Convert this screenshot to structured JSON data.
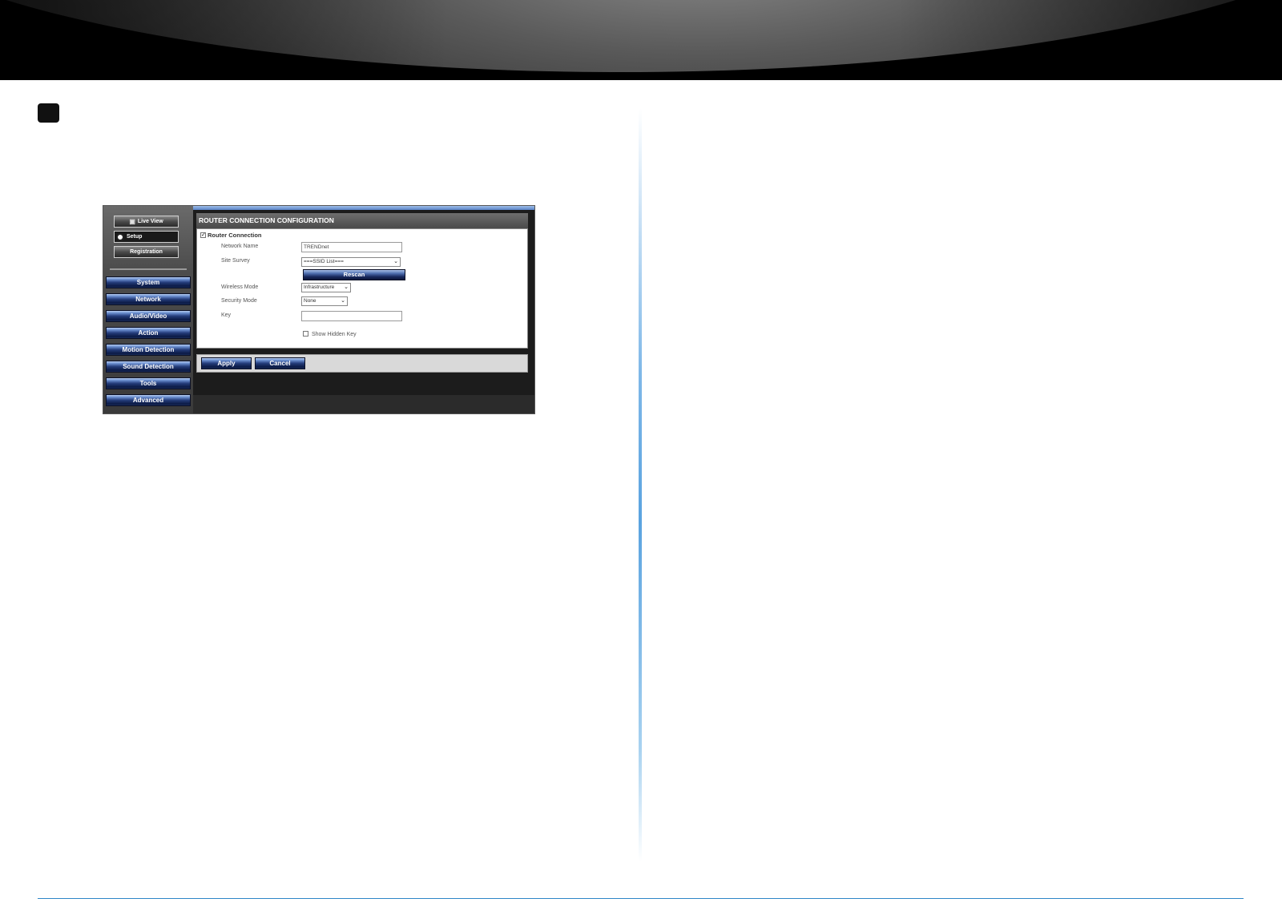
{
  "sidebar": {
    "top_buttons": {
      "live_view": "Live View",
      "setup": "Setup",
      "registration": "Registration"
    },
    "nav": [
      "System",
      "Network",
      "Audio/Video",
      "Action",
      "Motion Detection",
      "Sound Detection",
      "Tools",
      "Advanced"
    ]
  },
  "config": {
    "title": "ROUTER CONNECTION CONFIGURATION",
    "router_connection_label": "Router Connection",
    "router_connection_checked": true,
    "fields": {
      "network_name_label": "Network Name",
      "network_name_value": "TRENDnet",
      "site_survey_label": "Site Survey",
      "site_survey_value": "===SSID List===",
      "rescan_label": "Rescan",
      "wireless_mode_label": "Wireless Mode",
      "wireless_mode_value": "Infrastructure",
      "security_mode_label": "Security Mode",
      "security_mode_value": "None",
      "key_label": "Key",
      "key_value": "",
      "show_hidden_key_label": "Show Hidden Key",
      "show_hidden_key_checked": false
    }
  },
  "actions": {
    "apply_label": "Apply",
    "cancel_label": "Cancel"
  },
  "icons": {
    "live_view": "camera-icon",
    "setup": "gear-icon",
    "dropdown": "chevron-down-icon",
    "check": "checkmark-icon"
  },
  "colors": {
    "divider": "#5aa3e0",
    "nav_button": "#243c7a",
    "footer_rule": "#2f86c8"
  }
}
